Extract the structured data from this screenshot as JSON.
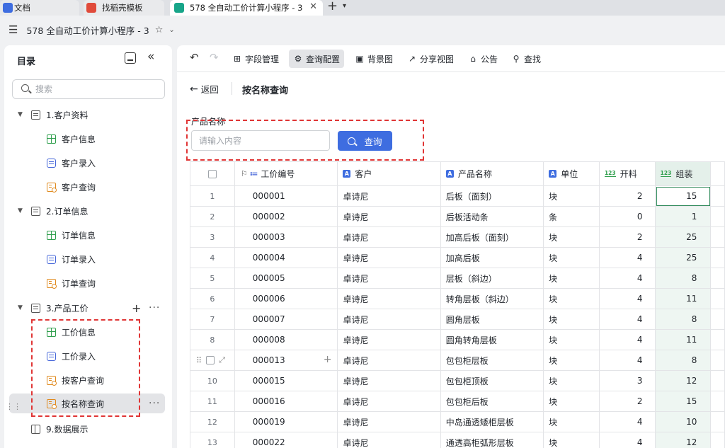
{
  "browser": {
    "tabs": [
      {
        "label": "文档",
        "color": "#3e6de0"
      },
      {
        "label": "找稻壳模板",
        "color": "#e04a3a"
      },
      {
        "label": "578 全自动工价计算小程序 - 3",
        "color": "#17a589"
      }
    ],
    "new_tab": "+",
    "tab_menu": "⌄"
  },
  "doc": {
    "title": "578 全自动工价计算小程序 - 3"
  },
  "sidebar": {
    "title": "目录",
    "search_placeholder": "搜索",
    "groups": [
      {
        "label": "1.客户资料",
        "items": [
          "客户信息",
          "客户录入",
          "客户查询"
        ]
      },
      {
        "label": "2.订单信息",
        "items": [
          "订单信息",
          "订单录入",
          "订单查询"
        ]
      },
      {
        "label": "3.产品工价",
        "items": [
          "工价信息",
          "工价录入",
          "按客户查询",
          "按名称查询"
        ]
      }
    ],
    "extra": "9.数据展示"
  },
  "toolbar": {
    "field_mgmt": "字段管理",
    "query_config": "查询配置",
    "background": "背景图",
    "share_view": "分享视图",
    "announcement": "公告",
    "find": "查找"
  },
  "page": {
    "back": "返回",
    "title": "按名称查询",
    "filter_label": "产品名称",
    "filter_placeholder": "请输入内容",
    "query_button": "查询"
  },
  "table": {
    "columns": [
      "工价编号",
      "客户",
      "产品名称",
      "单位",
      "开料",
      "组装"
    ],
    "rows": [
      {
        "idx": "1",
        "code": "000001",
        "customer": "卓诗尼",
        "product": "后板（面刻）",
        "unit": "块",
        "cut": "2",
        "assemble": "15"
      },
      {
        "idx": "2",
        "code": "000002",
        "customer": "卓诗尼",
        "product": "后板活动条",
        "unit": "条",
        "cut": "0",
        "assemble": "1"
      },
      {
        "idx": "3",
        "code": "000003",
        "customer": "卓诗尼",
        "product": "加高后板（面刻）",
        "unit": "块",
        "cut": "2",
        "assemble": "25"
      },
      {
        "idx": "4",
        "code": "000004",
        "customer": "卓诗尼",
        "product": "加高后板",
        "unit": "块",
        "cut": "4",
        "assemble": "25"
      },
      {
        "idx": "5",
        "code": "000005",
        "customer": "卓诗尼",
        "product": "层板（斜边）",
        "unit": "块",
        "cut": "4",
        "assemble": "8"
      },
      {
        "idx": "6",
        "code": "000006",
        "customer": "卓诗尼",
        "product": "转角层板（斜边）",
        "unit": "块",
        "cut": "4",
        "assemble": "11"
      },
      {
        "idx": "7",
        "code": "000007",
        "customer": "卓诗尼",
        "product": "圆角层板",
        "unit": "块",
        "cut": "4",
        "assemble": "8"
      },
      {
        "idx": "8",
        "code": "000008",
        "customer": "卓诗尼",
        "product": "圆角转角层板",
        "unit": "块",
        "cut": "4",
        "assemble": "11"
      },
      {
        "idx": "",
        "code": "000013",
        "customer": "卓诗尼",
        "product": "包包柜层板",
        "unit": "块",
        "cut": "4",
        "assemble": "8"
      },
      {
        "idx": "10",
        "code": "000015",
        "customer": "卓诗尼",
        "product": "包包柜顶板",
        "unit": "块",
        "cut": "3",
        "assemble": "12"
      },
      {
        "idx": "11",
        "code": "000016",
        "customer": "卓诗尼",
        "product": "包包柜后板",
        "unit": "块",
        "cut": "2",
        "assemble": "15"
      },
      {
        "idx": "12",
        "code": "000019",
        "customer": "卓诗尼",
        "product": "中岛通透矮柜层板",
        "unit": "块",
        "cut": "4",
        "assemble": "10"
      },
      {
        "idx": "13",
        "code": "000022",
        "customer": "卓诗尼",
        "product": "通透高柜弧形层板",
        "unit": "块",
        "cut": "4",
        "assemble": "12"
      }
    ]
  }
}
